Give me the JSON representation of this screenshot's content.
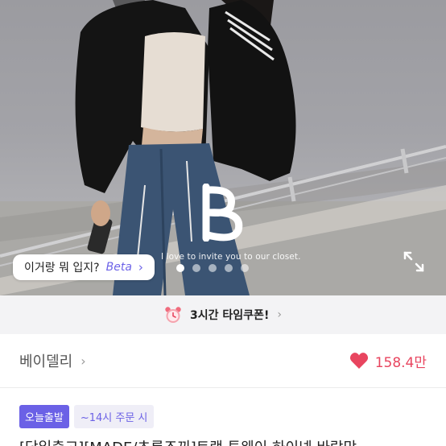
{
  "hero": {
    "tagline": "I love to invite you to our closet.",
    "slide_count": 5,
    "active_slide": 1,
    "info_chip": {
      "label": "이거랑 뭐 입지?",
      "beta": "Beta",
      "chevron": "›"
    },
    "expand_icon": "expand-icon",
    "logo_icon": "brand-b-logo"
  },
  "coupon_bar": {
    "icon": "alarm-clock-icon",
    "label": "3시간 타임쿠폰!",
    "chevron": "›"
  },
  "shop": {
    "name": "베이델리",
    "chevron": "›",
    "likes": "158.4만",
    "like_icon": "heart-icon",
    "like_color": "#e8455f"
  },
  "badges": {
    "today_shipping": "오늘출발",
    "order_cutoff": "~14시 주문 시"
  },
  "product": {
    "title": "[당일출고][MADE/초롱조끼]트랙 투웨이 하이넥 바람막"
  },
  "colors": {
    "accent": "#6b61e6",
    "heart": "#e8455f",
    "coupon_bg": "#f3f3f5"
  }
}
